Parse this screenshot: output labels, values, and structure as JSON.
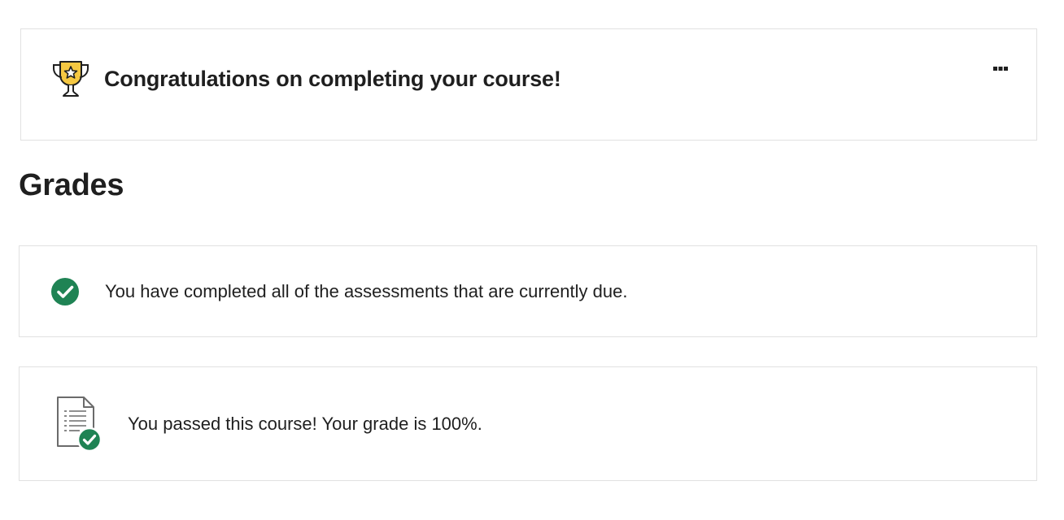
{
  "congrats_card": {
    "title": "Congratulations on completing your course!",
    "icon": "trophy-icon",
    "more_icon": "more-options-icon"
  },
  "grades": {
    "heading": "Grades"
  },
  "assessments_card": {
    "text": "You have completed all of the assessments that are currently due.",
    "icon": "check-circle-icon"
  },
  "passed_card": {
    "text": "You passed this course! Your grade is 100%.",
    "icon": "document-check-icon"
  },
  "colors": {
    "success_green": "#1f8354",
    "trophy_gold": "#f5c842",
    "border": "#e1e1e1",
    "text": "#1f1f1f"
  }
}
